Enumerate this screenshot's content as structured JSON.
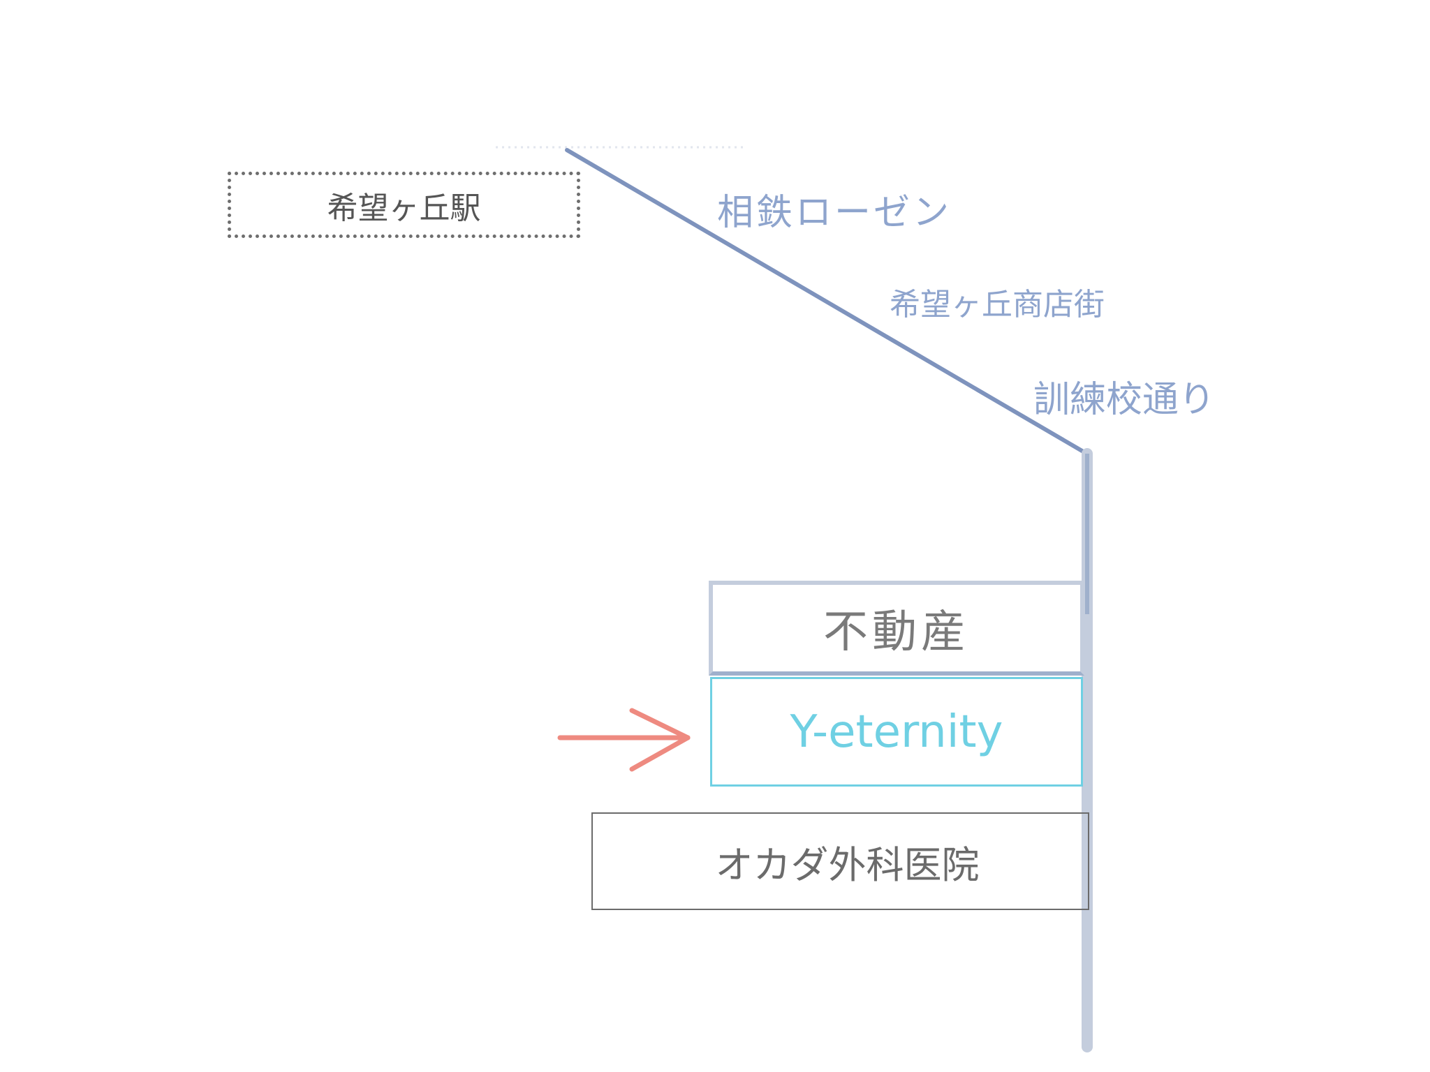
{
  "map": {
    "road_labels": {
      "railway": "相鉄ローゼン",
      "shopping_street": "希望ヶ丘商店街",
      "training_school_road": "訓練校通り"
    },
    "places": {
      "station": "希望ヶ丘駅",
      "real_estate": "不動産",
      "target": "Y-eternity",
      "clinic": "オカダ外科医院"
    },
    "colors": {
      "road": "#7e93bd",
      "road_light": "#c4cddd",
      "target": "#6fd0e3",
      "arrow": "#ee8a80",
      "box_border": "#6b6b6b"
    },
    "icons": {
      "pointer": "arrow-right-icon"
    }
  }
}
